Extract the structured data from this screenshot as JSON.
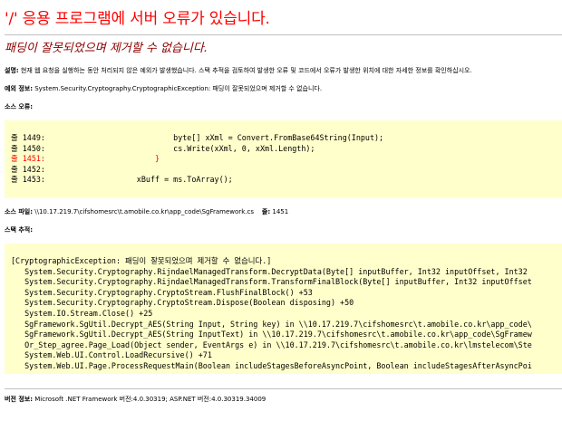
{
  "header": {
    "title": "'/' 응용 프로그램에 서버 오류가 있습니다.",
    "error_message": "패딩이 잘못되었으며 제거할 수 없습니다."
  },
  "description": {
    "label": "설명:",
    "text": "현재 웹 요청을 실행하는 동안 처리되지 않은 예외가 발생했습니다. 스택 추적을 검토하여 발생한 오류 및 코드에서 오류가 발생한 위치에 대한 자세한 정보를 확인하십시오."
  },
  "exception": {
    "label": "예외 정보:",
    "text": "System.Security.Cryptography.CryptographicException: 패딩이 잘못되었으며 제거할 수 없습니다."
  },
  "source_error": {
    "label": "소스 오류:",
    "lines": [
      {
        "num": "줄 1449:",
        "code": "                            byte[] xXml = Convert.FromBase64String(Input);"
      },
      {
        "num": "줄 1450:",
        "code": "                            cs.Write(xXml, 0, xXml.Length);"
      },
      {
        "num": "줄 1451:",
        "code": "                        }"
      },
      {
        "num": "줄 1452:",
        "code": ""
      },
      {
        "num": "줄 1453:",
        "code": "                    xBuff = ms.ToArray();"
      }
    ],
    "error_line_num": "줄 1451:"
  },
  "source_file": {
    "label": "소스 파일:",
    "path": "\\\\10.17.219.7\\cifshomesrc\\t.amobile.co.kr\\app_code\\SgFramework.cs",
    "line_label": "줄:",
    "line_value": "1451"
  },
  "stack_trace": {
    "label": "스택 추적:",
    "lines": [
      "[CryptographicException: 패딩이 잘못되었으며 제거할 수 없습니다.]",
      "   System.Security.Cryptography.RijndaelManagedTransform.DecryptData(Byte[] inputBuffer, Int32 inputOffset, Int32",
      "   System.Security.Cryptography.RijndaelManagedTransform.TransformFinalBlock(Byte[] inputBuffer, Int32 inputOffset",
      "   System.Security.Cryptography.CryptoStream.FlushFinalBlock() +53",
      "   System.Security.Cryptography.CryptoStream.Dispose(Boolean disposing) +50",
      "   System.IO.Stream.Close() +25",
      "   SgFramework.SgUtil.Decrypt_AES(String Input, String key) in \\\\10.17.219.7\\cifshomesrc\\t.amobile.co.kr\\app_code\\",
      "   SgFramework.SgUtil.Decrypt_AES(String InputText) in \\\\10.17.219.7\\cifshomesrc\\t.amobile.co.kr\\app_code\\SgFramew",
      "   Or_Step_agree.Page_Load(Object sender, EventArgs e) in \\\\10.17.219.7\\cifshomesrc\\t.amobile.co.kr\\lmstelecom\\Ste",
      "   System.Web.UI.Control.LoadRecursive() +71",
      "   System.Web.UI.Page.ProcessRequestMain(Boolean includeStagesBeforeAsyncPoint, Boolean includeStagesAfterAsyncPoi"
    ]
  },
  "version": {
    "label": "버전 정보:",
    "text": "Microsoft .NET Framework 버전:4.0.30319; ASP.NET 버전:4.0.30319.34009"
  },
  "colors": {
    "title": "#ff0000",
    "error_message": "#8b0000",
    "code_background": "#ffffcc",
    "error_line": "#ff0000"
  }
}
